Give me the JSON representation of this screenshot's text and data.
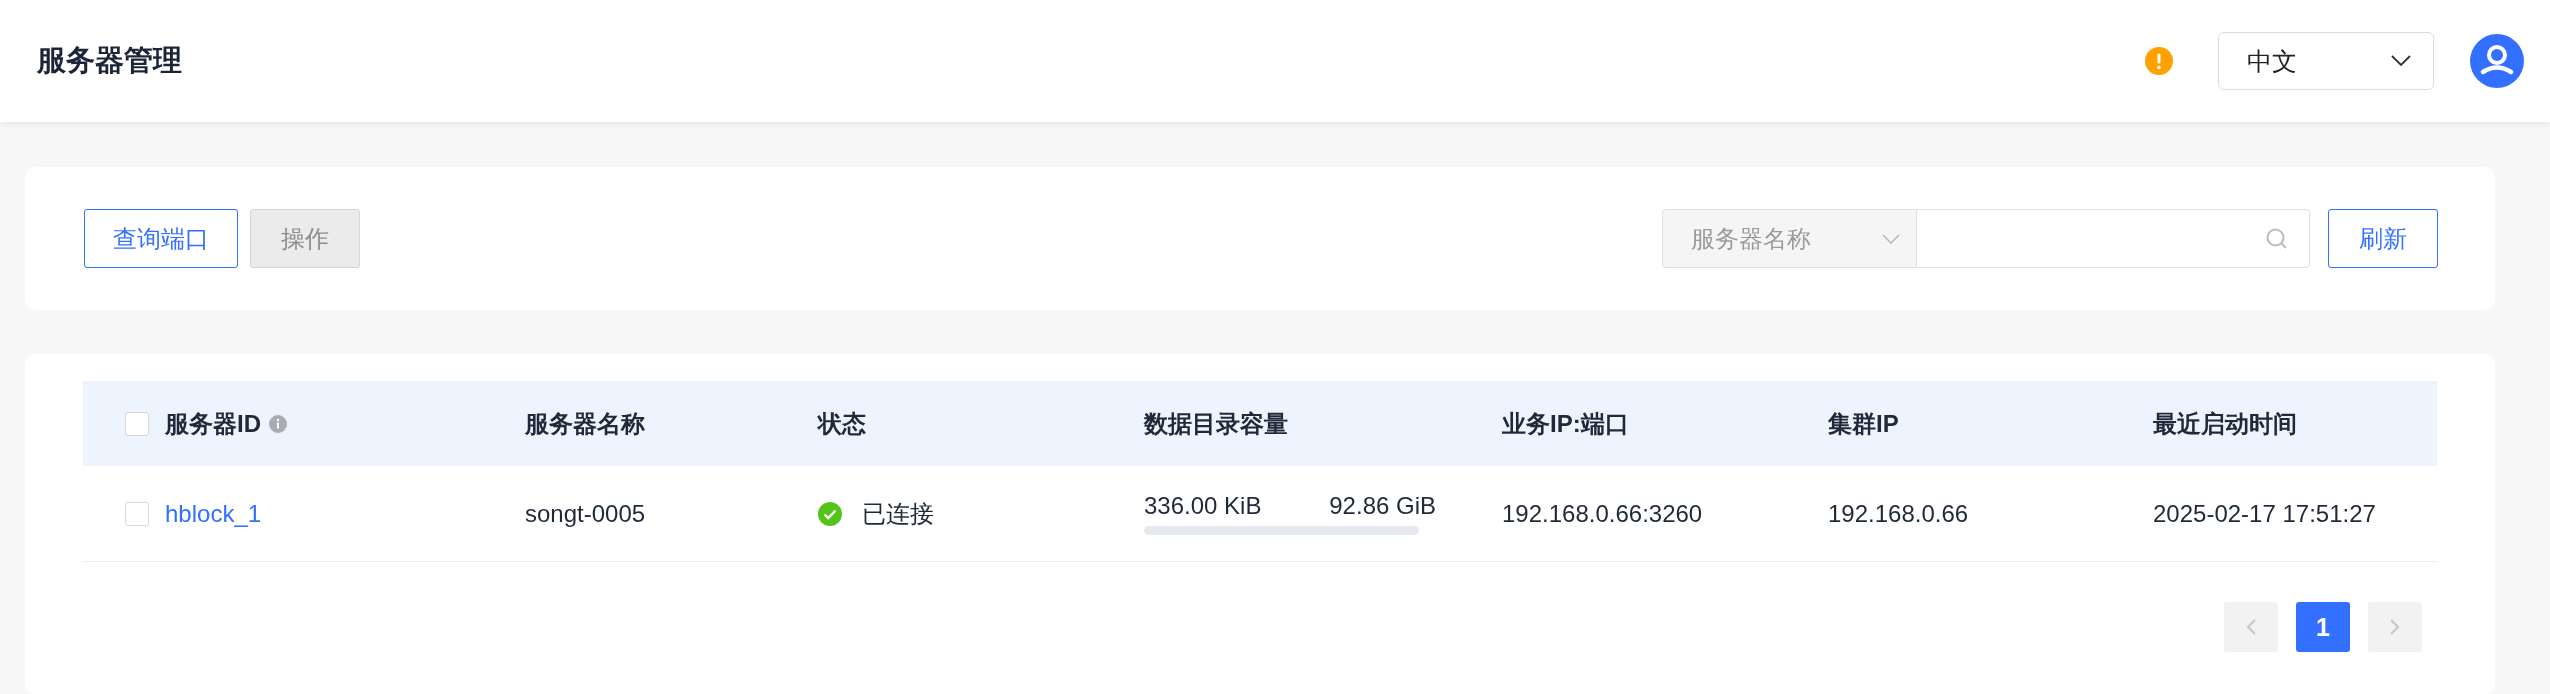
{
  "header": {
    "title": "服务器管理",
    "language": {
      "value": "中文"
    }
  },
  "toolbar": {
    "buttons": [
      {
        "label": "查询端口",
        "disabled": false
      },
      {
        "label": "操作",
        "disabled": true
      }
    ],
    "search": {
      "filter": "服务器名称"
    },
    "refresh": "刷新"
  },
  "table": {
    "columns": [
      {
        "label": "服务器ID",
        "info": true
      },
      {
        "label": "服务器名称"
      },
      {
        "label": "状态"
      },
      {
        "label": "数据目录容量"
      },
      {
        "label": "业务IP:端口"
      },
      {
        "label": "集群IP"
      },
      {
        "label": "最近启动时间"
      }
    ],
    "all_checked": false,
    "rows": [
      {
        "checked": false,
        "id": "hblock_1",
        "name": "songt-0005",
        "status": {
          "kind": "ok",
          "text": "已连接"
        },
        "capacity": {
          "used": "336.00 KiB",
          "total": "92.86 GiB",
          "level": 0
        },
        "ip_port": "192.168.0.66:3260",
        "cluster_ip": "192.168.0.66",
        "started": "2025-02-17 17:51:27"
      }
    ]
  },
  "pagination": {
    "pages": [
      {
        "label": "1",
        "selected": true
      }
    ]
  }
}
